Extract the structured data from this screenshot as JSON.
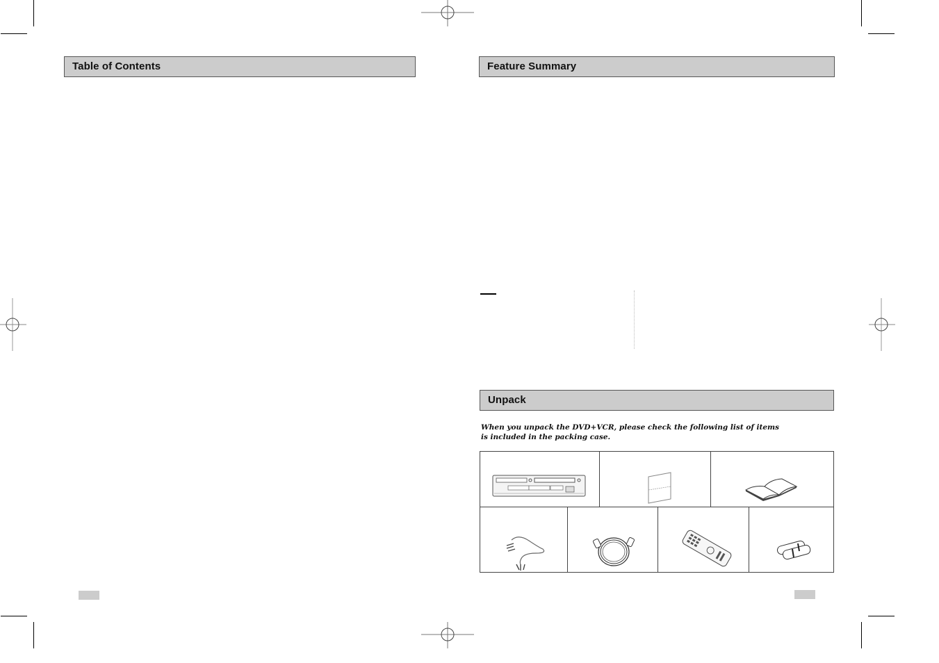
{
  "left_page": {
    "section_title": "Table of Contents"
  },
  "right_page": {
    "section_title": "Feature Summary",
    "unpack": {
      "section_title": "Unpack",
      "intro_text": "When you unpack the DVD+VCR, please check the following list of items is included in the packing case.",
      "items": [
        {
          "name": "DVD+VCR unit",
          "icon": "dvd-vcr-icon"
        },
        {
          "name": "Instruction sheet",
          "icon": "sheet-icon"
        },
        {
          "name": "Instruction manual",
          "icon": "manual-book-icon"
        },
        {
          "name": "Audio/Video cable",
          "icon": "av-cable-icon"
        },
        {
          "name": "RF antenna cable",
          "icon": "rf-cable-icon"
        },
        {
          "name": "Remote control",
          "icon": "remote-control-icon"
        },
        {
          "name": "Batteries",
          "icon": "batteries-icon"
        }
      ]
    }
  }
}
